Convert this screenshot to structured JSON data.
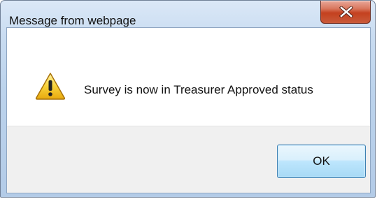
{
  "dialog": {
    "title": "Message from webpage",
    "close_icon": "close-icon",
    "message": "Survey is now in Treasurer Approved status",
    "icon": "warning-icon",
    "ok_label": "OK"
  },
  "colors": {
    "title_bar": "#c9dcf1",
    "close_button": "#c4411f",
    "footer": "#f0f0f0",
    "ok_button_border": "#3c7fb1",
    "warning_yellow": "#f8d23a"
  }
}
